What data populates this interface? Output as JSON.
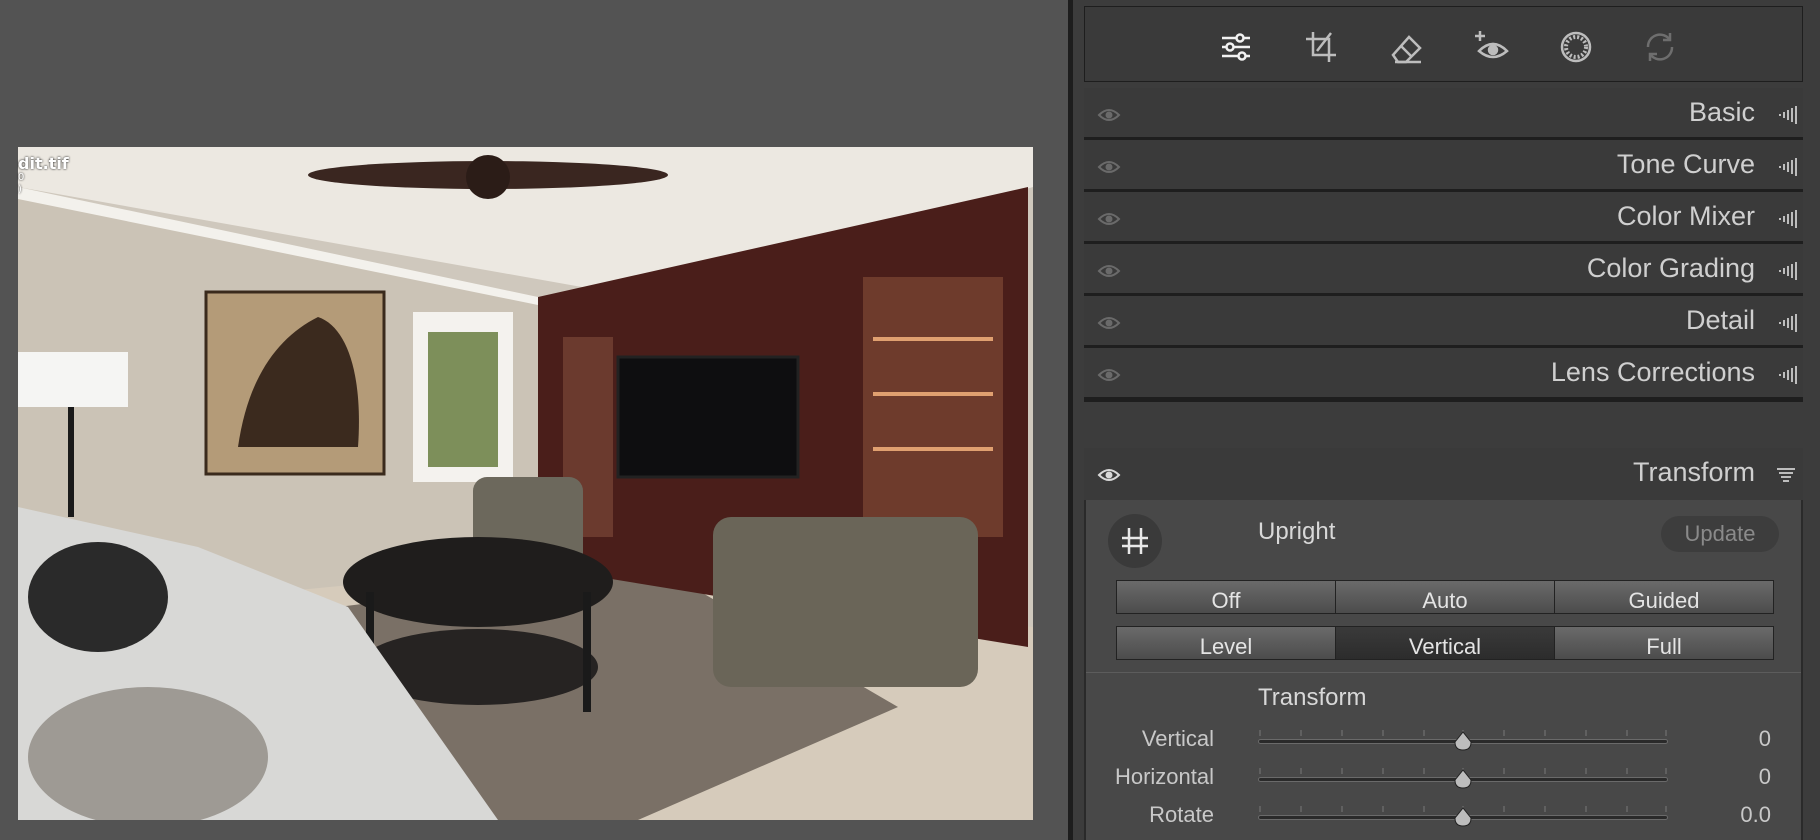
{
  "photo": {
    "filename_fragment": "dit.tif",
    "sub_line_1": "0",
    "sub_line_2": ")"
  },
  "toolbar": {
    "tools": [
      {
        "name": "edit-sliders-icon"
      },
      {
        "name": "crop-icon"
      },
      {
        "name": "healing-eraser-icon"
      },
      {
        "name": "red-eye-icon"
      },
      {
        "name": "masking-icon"
      },
      {
        "name": "presets-sync-icon"
      }
    ]
  },
  "panels": [
    {
      "title": "Basic"
    },
    {
      "title": "Tone Curve"
    },
    {
      "title": "Color Mixer"
    },
    {
      "title": "Color Grading"
    },
    {
      "title": "Detail"
    },
    {
      "title": "Lens Corrections"
    },
    {
      "title": "Transform"
    }
  ],
  "transform": {
    "upright_label": "Upright",
    "update_label": "Update",
    "upright_row1": [
      "Off",
      "Auto",
      "Guided"
    ],
    "upright_row2": [
      "Level",
      "Vertical",
      "Full"
    ],
    "active_mode": "Vertical",
    "section_label": "Transform",
    "sliders": [
      {
        "label": "Vertical",
        "value": "0",
        "position": 0.5
      },
      {
        "label": "Horizontal",
        "value": "0",
        "position": 0.5
      },
      {
        "label": "Rotate",
        "value": "0.0",
        "position": 0.5
      }
    ]
  },
  "colors": {
    "panel_bg": "#3c3c3c",
    "canvas_bg": "#535353",
    "active_segment": "#2c2c2c"
  }
}
